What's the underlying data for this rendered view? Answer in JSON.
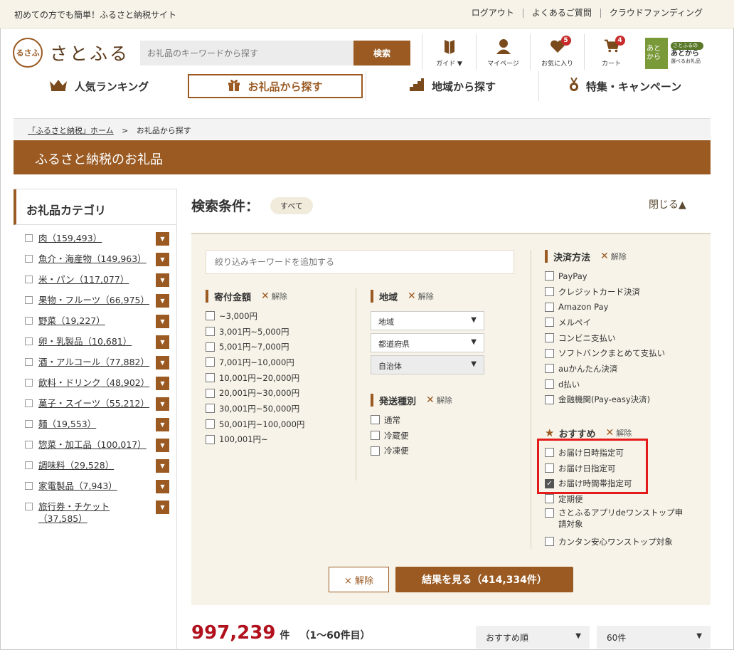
{
  "topbar": {
    "tagline": "初めての方でも簡単！ふるさと納税サイト",
    "links": [
      "ログアウト",
      "よくあるご質問",
      "クラウドファンディング"
    ]
  },
  "header": {
    "logo_mark": "るさふ",
    "site_name": "さとふる",
    "search_placeholder": "お礼品のキーワードから探す",
    "search_button": "検索",
    "icons": [
      {
        "label": "ガイド ▼",
        "icon": "book-icon"
      },
      {
        "label": "マイページ",
        "icon": "person-icon"
      },
      {
        "label": "お気に入り",
        "icon": "heart-icon",
        "badge": "5"
      },
      {
        "label": "カート",
        "icon": "cart-icon",
        "badge": "4"
      }
    ],
    "app": {
      "sq": "あと から",
      "pill": "さとふるの",
      "line1": "あとから",
      "line2": "選べるお礼品"
    }
  },
  "nav": [
    {
      "label": "人気ランキング",
      "icon": "crown-icon"
    },
    {
      "label": "お礼品から探す",
      "icon": "gift-icon"
    },
    {
      "label": "地域から探す",
      "icon": "map-icon"
    },
    {
      "label": "特集・キャンペーン",
      "icon": "medal-icon"
    }
  ],
  "breadcrumb": {
    "home": "「ふるさと納税」ホーム",
    "sep": ">",
    "current": "お礼品から探す"
  },
  "banner": "ふるさと納税のお礼品",
  "sidebar": {
    "title": "お礼品カテゴリ",
    "items": [
      "肉（159,493）",
      "魚介・海産物（149,963）",
      "米・パン（117,077）",
      "果物・フルーツ（66,975）",
      "野菜（19,227）",
      "卵・乳製品（10,681）",
      "酒・アルコール（77,882）",
      "飲料・ドリンク（48,902）",
      "菓子・スイーツ（55,212）",
      "麺（19,553）",
      "惣菜・加工品（100,017）",
      "調味料（29,528）",
      "家電製品（7,943）",
      "旅行券・チケット（37,585）"
    ]
  },
  "conditions": {
    "title": "検索条件：",
    "all_pill": "すべて",
    "close": "閉じる▲",
    "keyword_placeholder": "絞り込みキーワードを追加する",
    "clear": "解除",
    "amount": {
      "title": "寄付金額",
      "options": [
        "~3,000円",
        "3,001円~5,000円",
        "5,001円~7,000円",
        "7,001円~10,000円",
        "10,001円~20,000円",
        "20,001円~30,000円",
        "30,001円~50,000円",
        "50,001円~100,000円",
        "100,001円~"
      ]
    },
    "region": {
      "title": "地域",
      "selects": [
        "地域",
        "都道府県",
        "自治体"
      ]
    },
    "shipping": {
      "title": "発送種別",
      "options": [
        "通常",
        "冷蔵便",
        "冷凍便"
      ]
    },
    "payment": {
      "title": "決済方法",
      "options": [
        "PayPay",
        "クレジットカード決済",
        "Amazon Pay",
        "メルペイ",
        "コンビニ支払い",
        "ソフトバンクまとめて支払い",
        "auかんたん決済",
        "d払い",
        "金融機関(Pay-easy決済)"
      ]
    },
    "recommend": {
      "title": "おすすめ",
      "options": [
        {
          "label": "お届け日時指定可",
          "checked": false
        },
        {
          "label": "お届け日指定可",
          "checked": false
        },
        {
          "label": "お届け時間帯指定可",
          "checked": true
        },
        {
          "label": "定期便",
          "checked": false
        },
        {
          "label": "さとふるアプリdeワンストップ申請対象",
          "checked": false
        },
        {
          "label": "カンタン安心ワンストップ対象",
          "checked": false
        }
      ]
    },
    "reset_button": "× 解除",
    "result_button": "結果を見る（414,334件）"
  },
  "results": {
    "count": "997,239",
    "unit": "件",
    "range": "（1〜60件目）",
    "sort": "おすすめ順",
    "per_page": "60件"
  },
  "colors": {
    "brand": "#9a5a22",
    "highlight": "#e31b1b",
    "count": "#b1111d"
  }
}
